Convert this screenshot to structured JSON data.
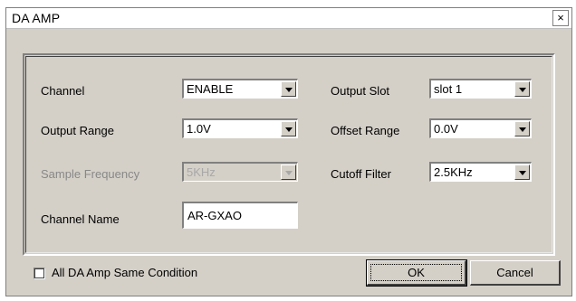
{
  "window": {
    "title": "DA AMP",
    "close_glyph": "×"
  },
  "fields": {
    "channel": {
      "label": "Channel",
      "value": "ENABLE"
    },
    "output_range": {
      "label": "Output Range",
      "value": "1.0V"
    },
    "sample_frequency": {
      "label": "Sample Frequency",
      "value": "5KHz",
      "disabled": true
    },
    "channel_name": {
      "label": "Channel Name",
      "value": "AR-GXAO"
    },
    "output_slot": {
      "label": "Output Slot",
      "value": "slot 1"
    },
    "offset_range": {
      "label": "Offset Range",
      "value": "0.0V"
    },
    "cutoff_filter": {
      "label": "Cutoff Filter",
      "value": "2.5KHz"
    }
  },
  "footer": {
    "same_condition_label": "All DA Amp Same Condition",
    "same_condition_checked": false,
    "ok_label": "OK",
    "cancel_label": "Cancel"
  },
  "colors": {
    "face": "#d4d0c8",
    "disabled_text": "#a8a8a8"
  }
}
